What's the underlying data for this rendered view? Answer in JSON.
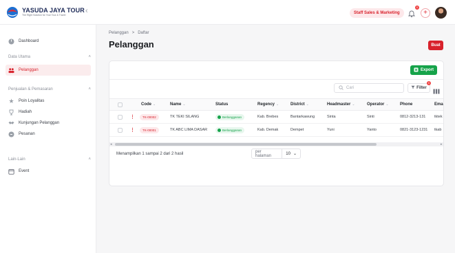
{
  "app": {
    "brand_title": "YASUDA JAYA TOUR",
    "brand_subtitle": "The Right Solution for Your Tour & Travel",
    "role_badge": "Staff Sales & Marketing",
    "notification_count": "0",
    "accent_color": "#d8222c"
  },
  "sidebar": {
    "dashboard": "Dashboard",
    "group_data_utama": "Data Utama",
    "pelanggan": "Pelanggan",
    "group_penjualan": "Penjualan & Pemasaran",
    "poin_loyalitas": "Poin Loyalitas",
    "hadiah": "Hadiah",
    "kunjungan": "Kunjungan Pelanggan",
    "pesanan": "Pesanan",
    "group_lain": "Lain-Lain",
    "event": "Event"
  },
  "page": {
    "breadcrumb_parent": "Pelanggan",
    "breadcrumb_sep": ">",
    "breadcrumb_current": "Daftar",
    "title": "Pelanggan",
    "create_label": "Buat"
  },
  "toolbar": {
    "export_label": "Export",
    "search_placeholder": "Cari",
    "filter_label": "Filter",
    "filter_count": "0"
  },
  "table": {
    "columns": [
      "Code",
      "Name",
      "Status",
      "Regency",
      "District",
      "Headmaster",
      "Operator",
      "Phone",
      "Ema"
    ],
    "rows": [
      {
        "code": "TK-00002",
        "name": "TK TEKI SILANG",
        "status": "Berlangganan",
        "regency": "Kab. Brebes",
        "district": "Bantarkawung",
        "headmaster": "Sinta",
        "operator": "Sinti",
        "phone": "0812-3213-131",
        "email": "tktek"
      },
      {
        "code": "TK-00001",
        "name": "TK ABC LIMA DASAR",
        "status": "Berlangganan",
        "regency": "Kab. Demak",
        "district": "Dempet",
        "headmaster": "Yuni",
        "operator": "Yanto",
        "phone": "0821-3123-1231",
        "email": "tkab"
      }
    ]
  },
  "footer": {
    "summary": "Menampilkan 1 sampai 2 dari 2 hasil",
    "per_page_label": "per halaman",
    "per_page_value": "10"
  }
}
